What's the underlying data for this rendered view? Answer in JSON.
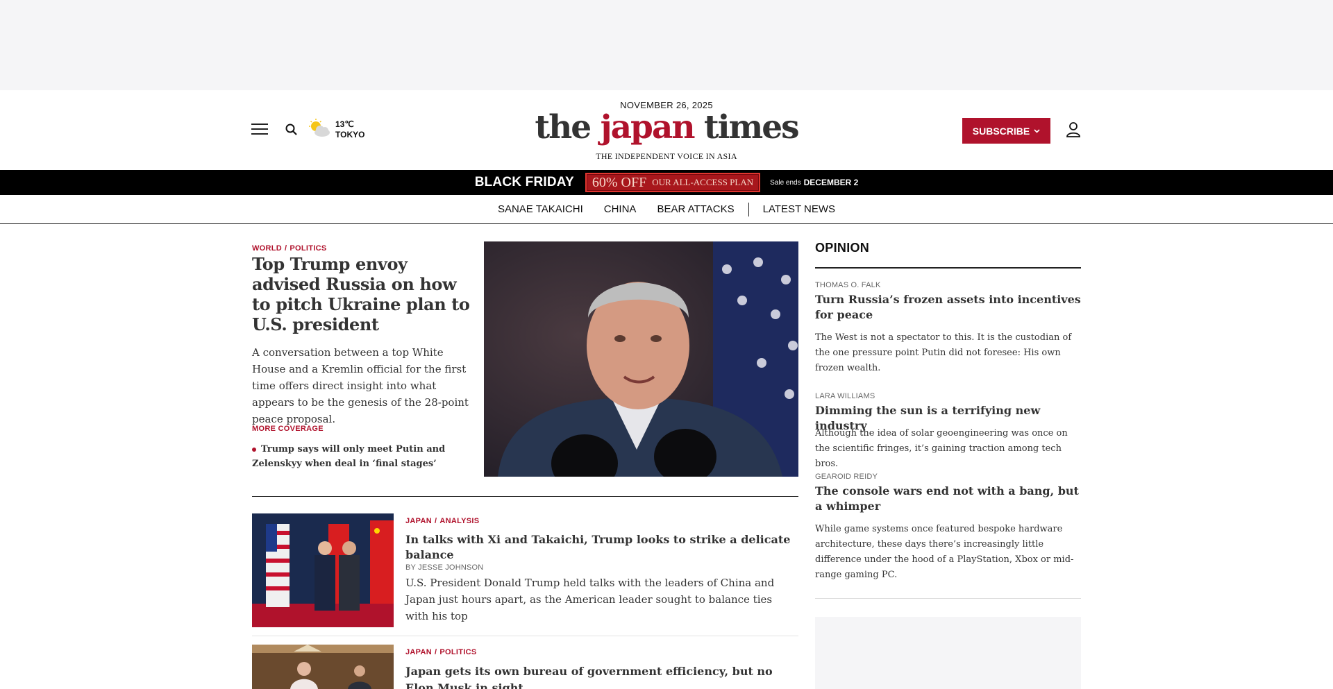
{
  "header": {
    "date": "NOVEMBER 26, 2025",
    "logo_the": "the ",
    "logo_japan": "japan",
    "logo_times": " times",
    "tagline": "THE INDEPENDENT VOICE IN ASIA",
    "weather_temp": "13℃",
    "weather_city": "TOKYO",
    "subscribe_label": "SUBSCRIBE",
    "icons": [
      "hamburger-icon",
      "search-icon",
      "partly-cloudy-icon",
      "chevron-down-icon",
      "user-icon"
    ],
    "accent_color": "#b0122c"
  },
  "promo": {
    "title": "BLACK FRIDAY",
    "discount": "60% OFF",
    "plan": "OUR ALL-ACCESS PLAN",
    "ends_label": "Sale ends",
    "ends_date": "DECEMBER 2"
  },
  "nav": {
    "items": [
      "SANAE TAKAICHI",
      "CHINA",
      "BEAR ATTACKS",
      "LATEST NEWS"
    ]
  },
  "lead": {
    "section": "WORLD",
    "subsection": "POLITICS",
    "headline": "Top Trump envoy advised Russia on how to pitch Ukraine plan to U.S. president",
    "summary": "A conversation between a top White House and a Kremlin official for the first time offers direct insight into what appears to be the genesis of the 28-point peace proposal.",
    "more_coverage_label": "MORE COVERAGE",
    "more_coverage_items": [
      "Trump says will only meet Putin and Zelenskyy when deal in ‘final stages’"
    ]
  },
  "stories": [
    {
      "section": "JAPAN",
      "subsection": "ANALYSIS",
      "headline": "In talks with Xi and Takaichi, Trump looks to strike a delicate balance",
      "byline": "BY JESSE JOHNSON",
      "summary": "U.S. President Donald Trump held talks with the leaders of China and Japan just hours apart, as the American leader sought to balance ties with his top"
    },
    {
      "section": "JAPAN",
      "subsection": "POLITICS",
      "headline": "Japan gets its own bureau of government efficiency, but no Elon Musk in sight"
    }
  ],
  "opinion": {
    "title": "OPINION",
    "items": [
      {
        "author": "THOMAS O. FALK",
        "headline": "Turn Russia’s frozen assets into incentives for peace",
        "summary": "The West is not a spectator to this. It is the custodian of the one pressure point Putin did not foresee: His own frozen wealth."
      },
      {
        "author": "LARA WILLIAMS",
        "headline": "Dimming the sun is a terrifying new industry",
        "summary": "Although the idea of solar geoengineering was once on the scientific fringes, it’s gaining traction among tech bros."
      },
      {
        "author": "GEAROID REIDY",
        "headline": "The console wars end not with a bang, but a whimper",
        "summary": "While game systems once featured bespoke hardware architecture, these days there’s increasingly little difference under the hood of a PlayStation, Xbox or mid-range gaming PC."
      }
    ]
  }
}
